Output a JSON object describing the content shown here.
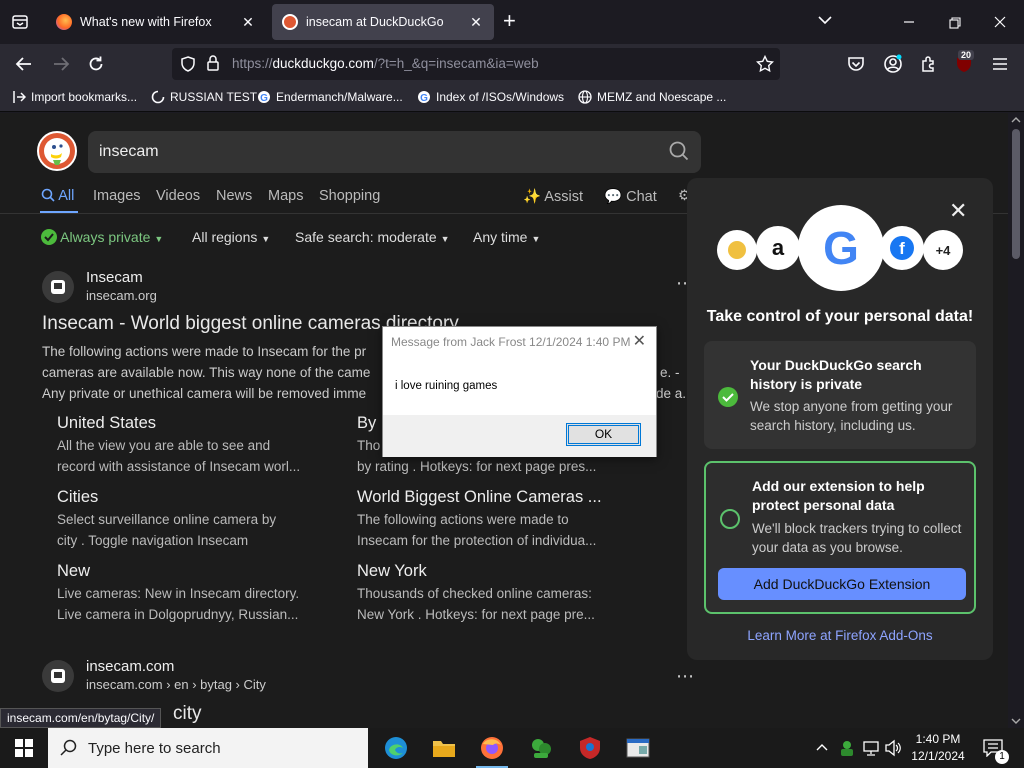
{
  "browser": {
    "tabs": [
      {
        "title": "What's new with Firefox",
        "active": false
      },
      {
        "title": "insecam at DuckDuckGo",
        "active": true
      }
    ],
    "url": {
      "prefix": "https://",
      "host": "duckduckgo.com",
      "rest": "/?t=h_&q=insecam&ia=web"
    },
    "extension_badge": "20",
    "bookmarks": [
      {
        "label": "Import bookmarks...",
        "icon": "import-icon"
      },
      {
        "label": "RUSSIAN TEST",
        "icon": "loading-icon"
      },
      {
        "label": "Endermanch/Malware...",
        "icon": "google-icon"
      },
      {
        "label": "Index of /ISOs/Windows",
        "icon": "google-icon"
      },
      {
        "label": "MEMZ and Noescape ...",
        "icon": "globe-icon"
      }
    ]
  },
  "search": {
    "query": "insecam",
    "tabs": [
      "All",
      "Images",
      "Videos",
      "News",
      "Maps",
      "Shopping"
    ],
    "assist": "Assist",
    "chat": "Chat",
    "filters": {
      "privacy": "Always private",
      "region": "All regions",
      "safe": "Safe search: moderate",
      "time": "Any time"
    }
  },
  "results": [
    {
      "site_name": "Insecam",
      "site_url": "insecam.org",
      "title": "Insecam - World biggest online cameras directory",
      "snippet": [
        "The following actions were made to Insecam for the pr",
        "cameras are available now. This way none of the came",
        "Any private or unethical camera will be removed imme"
      ],
      "snippet_tail": [
        "",
        "e. -",
        "de a..."
      ],
      "sitelinks": [
        {
          "title": "United States",
          "desc": [
            "All the view you are able to see and",
            "record with assistance of Insecam worl..."
          ]
        },
        {
          "title": "By",
          "desc": [
            "Tho",
            "by rating . Hotkeys: for next page pres..."
          ]
        },
        {
          "title": "Cities",
          "desc": [
            "Select surveillance online camera by",
            "city . Toggle navigation Insecam"
          ]
        },
        {
          "title": "World Biggest Online Cameras ...",
          "desc": [
            "The following actions were made to",
            "Insecam for the protection of individua..."
          ]
        },
        {
          "title": "New",
          "desc": [
            "Live cameras: New in Insecam directory.",
            "Live camera in Dolgoprudnyy, Russian..."
          ]
        },
        {
          "title": "New York",
          "desc": [
            "Thousands of checked online cameras:",
            "New York . Hotkeys: for next page pre..."
          ]
        }
      ]
    },
    {
      "site_name": "insecam.com",
      "site_url": "insecam.com › en › bytag › City",
      "title": "city"
    }
  ],
  "panel": {
    "more_count": "+4",
    "heading": "Take control of your personal data!",
    "card1": {
      "title": "Your DuckDuckGo search history is private",
      "desc": "We stop anyone from getting your search history, including us."
    },
    "card2": {
      "title": "Add our extension to help protect personal data",
      "desc": "We'll block trackers trying to collect your data as you browse.",
      "button": "Add DuckDuckGo Extension"
    },
    "learn_more": "Learn More at Firefox Add-Ons"
  },
  "messagebox": {
    "title": "Message from Jack Frost  12/1/2024 1:40 PM",
    "text": "i love ruining games",
    "ok": "OK"
  },
  "status_link": "insecam.com/en/bytag/City/",
  "taskbar": {
    "search_placeholder": "Type here to search",
    "time": "1:40 PM",
    "date": "12/1/2024",
    "notification_count": "1"
  }
}
